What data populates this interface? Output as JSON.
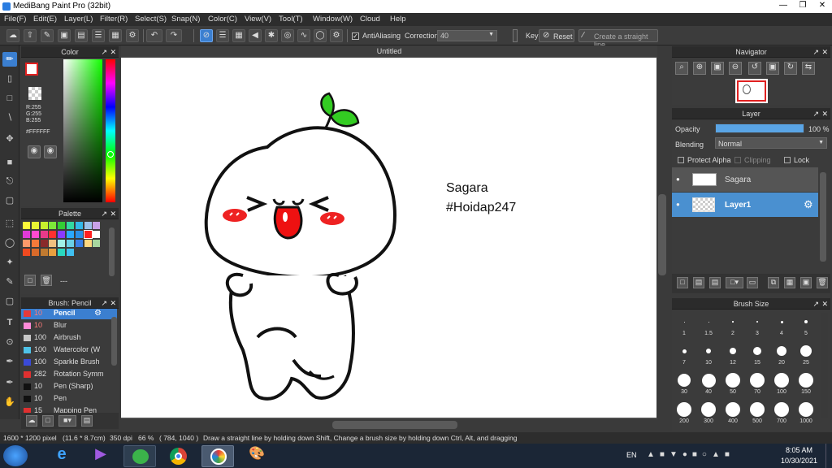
{
  "app": {
    "title": "MediBang Paint Pro (32bit)"
  },
  "menu": [
    "File(F)",
    "Edit(E)",
    "Layer(L)",
    "Filter(R)",
    "Select(S)",
    "Snap(N)",
    "Color(C)",
    "View(V)",
    "Tool(T)",
    "Window(W)",
    "Cloud",
    "Help"
  ],
  "toolbar": {
    "antialiasing_label": "AntiAliasing",
    "correction_label": "Correction",
    "correction_value": "40",
    "key_label": "Key",
    "reset_label": "Reset",
    "straight_line_label": "Create a straight line"
  },
  "color_panel": {
    "title": "Color",
    "r": "R:255",
    "g": "G:255",
    "b": "B:255",
    "hex": "#FFFFFF"
  },
  "palette_panel": {
    "title": "Palette",
    "footer_value": "---"
  },
  "brush_panel": {
    "title": "Brush: Pencil",
    "items": [
      {
        "size": "10",
        "name": "Pencil",
        "color": "#e63a3a"
      },
      {
        "size": "10",
        "name": "Blur",
        "color": "#ff8ad8"
      },
      {
        "size": "100",
        "name": "Airbrush",
        "color": "#c8c8c8"
      },
      {
        "size": "100",
        "name": "Watercolor (W",
        "color": "#4fc3e8"
      },
      {
        "size": "100",
        "name": "Sparkle Brush",
        "color": "#3a4ad8"
      },
      {
        "size": "282",
        "name": "Rotation Symm",
        "color": "#e03030"
      },
      {
        "size": "10",
        "name": "Pen (Sharp)",
        "color": "#111111"
      },
      {
        "size": "10",
        "name": "Pen",
        "color": "#111111"
      },
      {
        "size": "15",
        "name": "Mapping Pen",
        "color": "#e03030"
      }
    ]
  },
  "canvas": {
    "tab_title": "Untitled",
    "text_line1": "Sagara",
    "text_line2": "#Hoidap247"
  },
  "navigator": {
    "title": "Navigator"
  },
  "layer_panel": {
    "title": "Layer",
    "opacity_label": "Opacity",
    "opacity_value": "100 %",
    "opacity_fraction": 1.0,
    "blending_label": "Blending",
    "blending_value": "Normal",
    "protect_alpha_label": "Protect Alpha",
    "clipping_label": "Clipping",
    "lock_label": "Lock",
    "layers": [
      {
        "name": "Sagara"
      },
      {
        "name": "Layer1"
      }
    ]
  },
  "brush_size_panel": {
    "title": "Brush Size",
    "sizes": [
      "1",
      "1.5",
      "2",
      "3",
      "4",
      "5",
      "7",
      "10",
      "12",
      "15",
      "20",
      "25",
      "30",
      "40",
      "50",
      "70",
      "100",
      "150",
      "200",
      "300",
      "400",
      "500",
      "700",
      "1000"
    ]
  },
  "status": {
    "dimensions": "1600 * 1200 pixel",
    "physical": "(11.6 * 8.7cm)",
    "dpi": "350 dpi",
    "zoom": "66 %",
    "coords": "( 784, 1040 )",
    "hint": "Draw a straight line by holding down Shift, Change a brush size by holding down Ctrl, Alt, and dragging"
  },
  "taskbar": {
    "language": "EN",
    "time": "8:05 AM",
    "date": "10/30/2021"
  },
  "colors": {
    "accent": "#3b7fd0",
    "selected_layer": "#4a90d0",
    "leaf_green": "#33cc22",
    "cheek_red": "#ee2222"
  }
}
